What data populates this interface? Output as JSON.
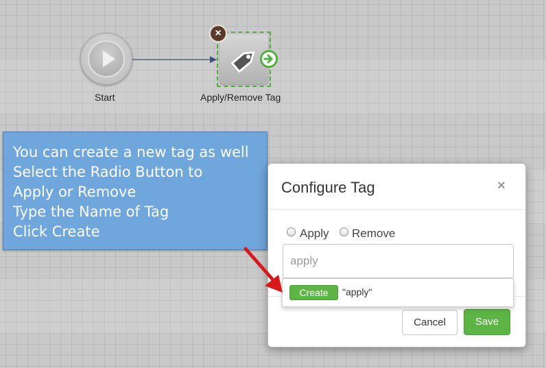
{
  "canvas": {
    "start_node": {
      "label": "Start",
      "icon": "play-icon"
    },
    "tag_node": {
      "label": "Apply/Remove Tag",
      "icon": "tag-icon",
      "delete_icon": "close-circle-icon",
      "port_icon": "arrow-right-circle-icon"
    }
  },
  "callout": {
    "lines": [
      "You can create a new tag as well",
      "Select the Radio Button to",
      "Apply or Remove",
      "Type the Name of Tag",
      "Click Create"
    ]
  },
  "modal": {
    "title": "Configure Tag",
    "close_glyph": "×",
    "radio_apply": "Apply",
    "radio_remove": "Remove",
    "input_value": "apply",
    "suggestion": {
      "button": "Create",
      "text": "\"apply\""
    },
    "cancel": "Cancel",
    "save": "Save"
  },
  "colors": {
    "accent_green": "#5cb544",
    "callout_blue": "#6fa6dc",
    "arrow_red": "#d9181c"
  }
}
